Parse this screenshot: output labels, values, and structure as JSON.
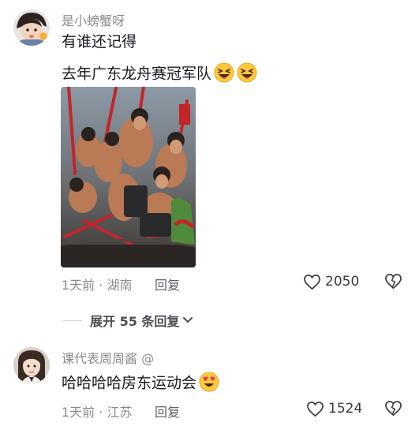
{
  "comments": [
    {
      "username": "是小螃蟹呀",
      "lines": [
        "有谁还记得",
        "去年广东龙舟赛冠军队"
      ],
      "time_location": "1天前 · 湖南",
      "reply_label": "回复",
      "like_count": "2050",
      "avatar_icon": "child-avatar",
      "emoji_icons": [
        "grin-squint-emoji",
        "grin-squint-emoji"
      ],
      "image_icon": "dragon-boat-photo"
    },
    {
      "username": "课代表周周酱 @",
      "lines": [
        "哈哈哈哈房东运动会"
      ],
      "time_location": "1天前 · 江苏",
      "reply_label": "回复",
      "like_count": "1524",
      "avatar_icon": "girl-avatar",
      "emoji_icons": [
        "heart-eyes-emoji"
      ]
    }
  ],
  "expand_replies": {
    "label": "展开 55 条回复"
  },
  "colors": {
    "meta": "#8a8b91",
    "text": "#161823",
    "emoji": "#ffc83d"
  }
}
